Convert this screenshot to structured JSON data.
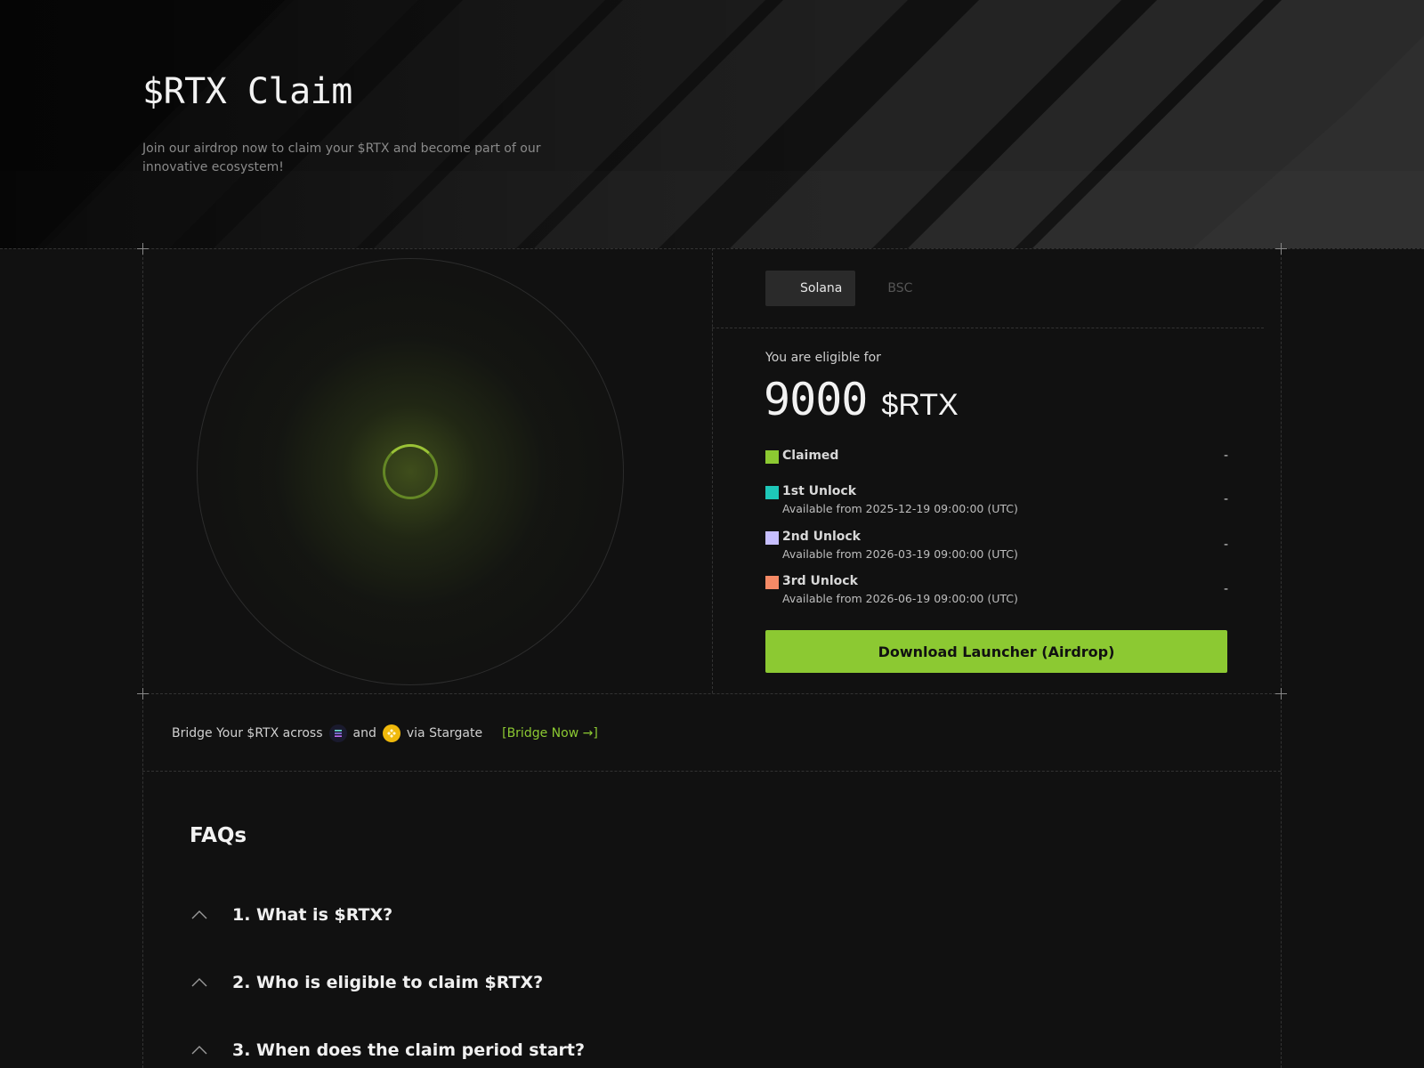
{
  "hero": {
    "title": "$RTX Claim",
    "subtitle": "Join our airdrop now to claim your $RTX and become part of our innovative ecosystem!"
  },
  "network_tabs": [
    {
      "label": "Solana",
      "active": true
    },
    {
      "label": "BSC",
      "active": false
    }
  ],
  "eligibility": {
    "label": "You are eligible for",
    "amount": "9000",
    "unit": "$RTX"
  },
  "unlocks": [
    {
      "name": "Claimed",
      "sub": "",
      "value": "-",
      "color": "#8cc932"
    },
    {
      "name": "1st Unlock",
      "sub": "Available from 2025-12-19 09:00:00 (UTC)",
      "value": "-",
      "color": "#1ec7b8"
    },
    {
      "name": "2nd Unlock",
      "sub": "Available from 2026-03-19 09:00:00 (UTC)",
      "value": "-",
      "color": "#c7bfff"
    },
    {
      "name": "3rd Unlock",
      "sub": "Available from 2026-06-19 09:00:00 (UTC)",
      "value": "-",
      "color": "#f58a66"
    }
  ],
  "download_button": "Download Launcher (Airdrop)",
  "bridge": {
    "text_before": "Bridge Your $RTX across",
    "text_and": "and",
    "text_after": "via Stargate",
    "link": "[Bridge Now →]",
    "icons": [
      "solana-icon",
      "bnb-icon"
    ]
  },
  "faq": {
    "title": "FAQs",
    "items": [
      "1. What is $RTX?",
      "2. Who is eligible to claim $RTX?",
      "3. When does the claim period start?"
    ]
  },
  "colors": {
    "accent": "#8cc932",
    "background": "#111111"
  }
}
